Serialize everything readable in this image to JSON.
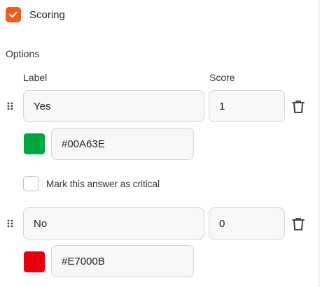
{
  "scoring": {
    "label": "Scoring",
    "checked": true
  },
  "options_title": "Options",
  "columns": {
    "label": "Label",
    "score": "Score"
  },
  "options": [
    {
      "label": "Yes",
      "score": "1",
      "color": "#00A63E",
      "color_text": "#00A63E"
    },
    {
      "label": "No",
      "score": "0",
      "color": "#E7000B",
      "color_text": "#E7000B"
    }
  ],
  "critical": {
    "label": "Mark this answer as critical",
    "checked": false
  },
  "colors": {
    "accent": "#F25C1A"
  },
  "icons": {
    "drag": "drag-handle-icon",
    "delete": "trash-icon",
    "check": "check-icon"
  }
}
